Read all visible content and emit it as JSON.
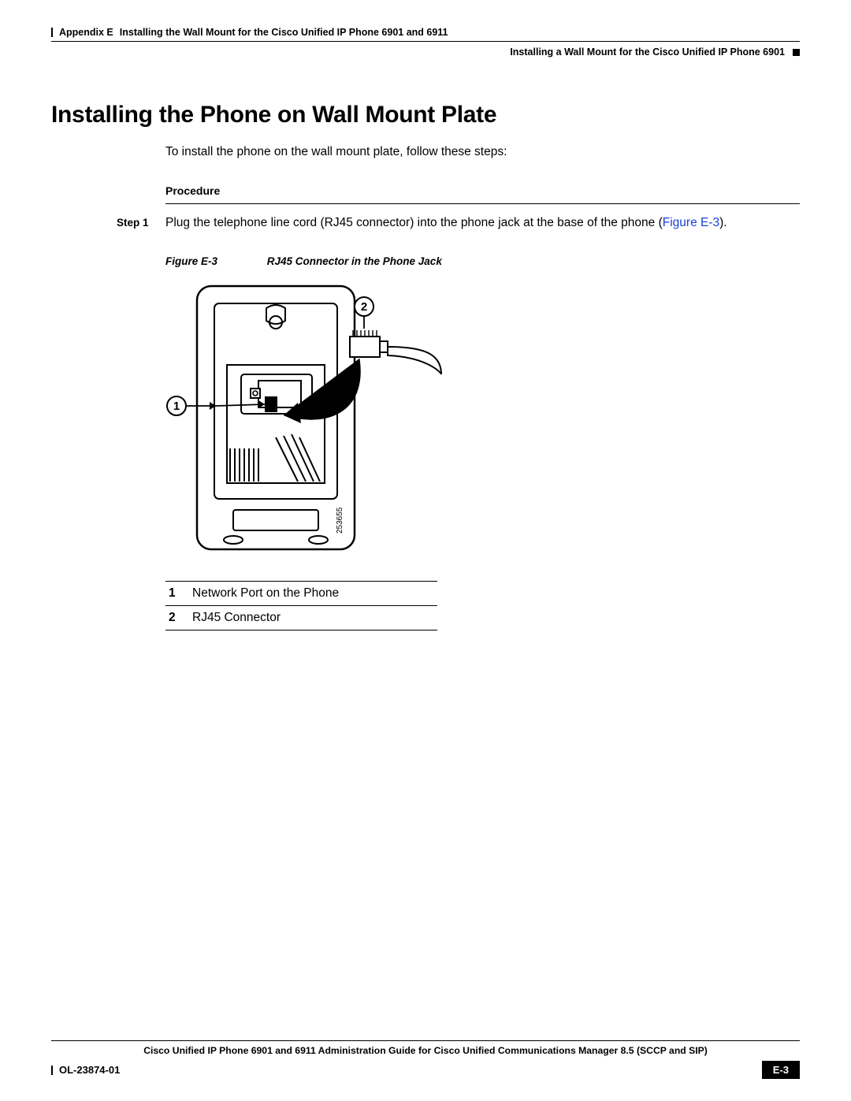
{
  "header": {
    "appendix": "Appendix E",
    "chapter_title": "Installing the Wall Mount for the Cisco Unified IP Phone 6901 and 6911",
    "section_title": "Installing a Wall Mount for the Cisco Unified IP Phone 6901"
  },
  "main": {
    "heading": "Installing the Phone on Wall Mount Plate",
    "intro": "To install the phone on the wall mount plate, follow these steps:",
    "procedure_label": "Procedure",
    "step": {
      "label": "Step 1",
      "text_before": "Plug the telephone line cord (RJ45 connector) into the phone jack at the base of the phone (",
      "xref": "Figure E-3",
      "text_after": ")."
    },
    "figure": {
      "label": "Figure E-3",
      "caption": "RJ45 Connector in the Phone Jack",
      "callout_1": "1",
      "callout_2": "2",
      "image_number": "253655"
    },
    "legend": [
      {
        "num": "1",
        "desc": "Network Port on the Phone"
      },
      {
        "num": "2",
        "desc": "RJ45 Connector"
      }
    ]
  },
  "footer": {
    "guide_title": "Cisco Unified IP Phone 6901 and 6911 Administration Guide for Cisco Unified Communications Manager 8.5 (SCCP and SIP)",
    "doc_number": "OL-23874-01",
    "page": "E-3"
  }
}
